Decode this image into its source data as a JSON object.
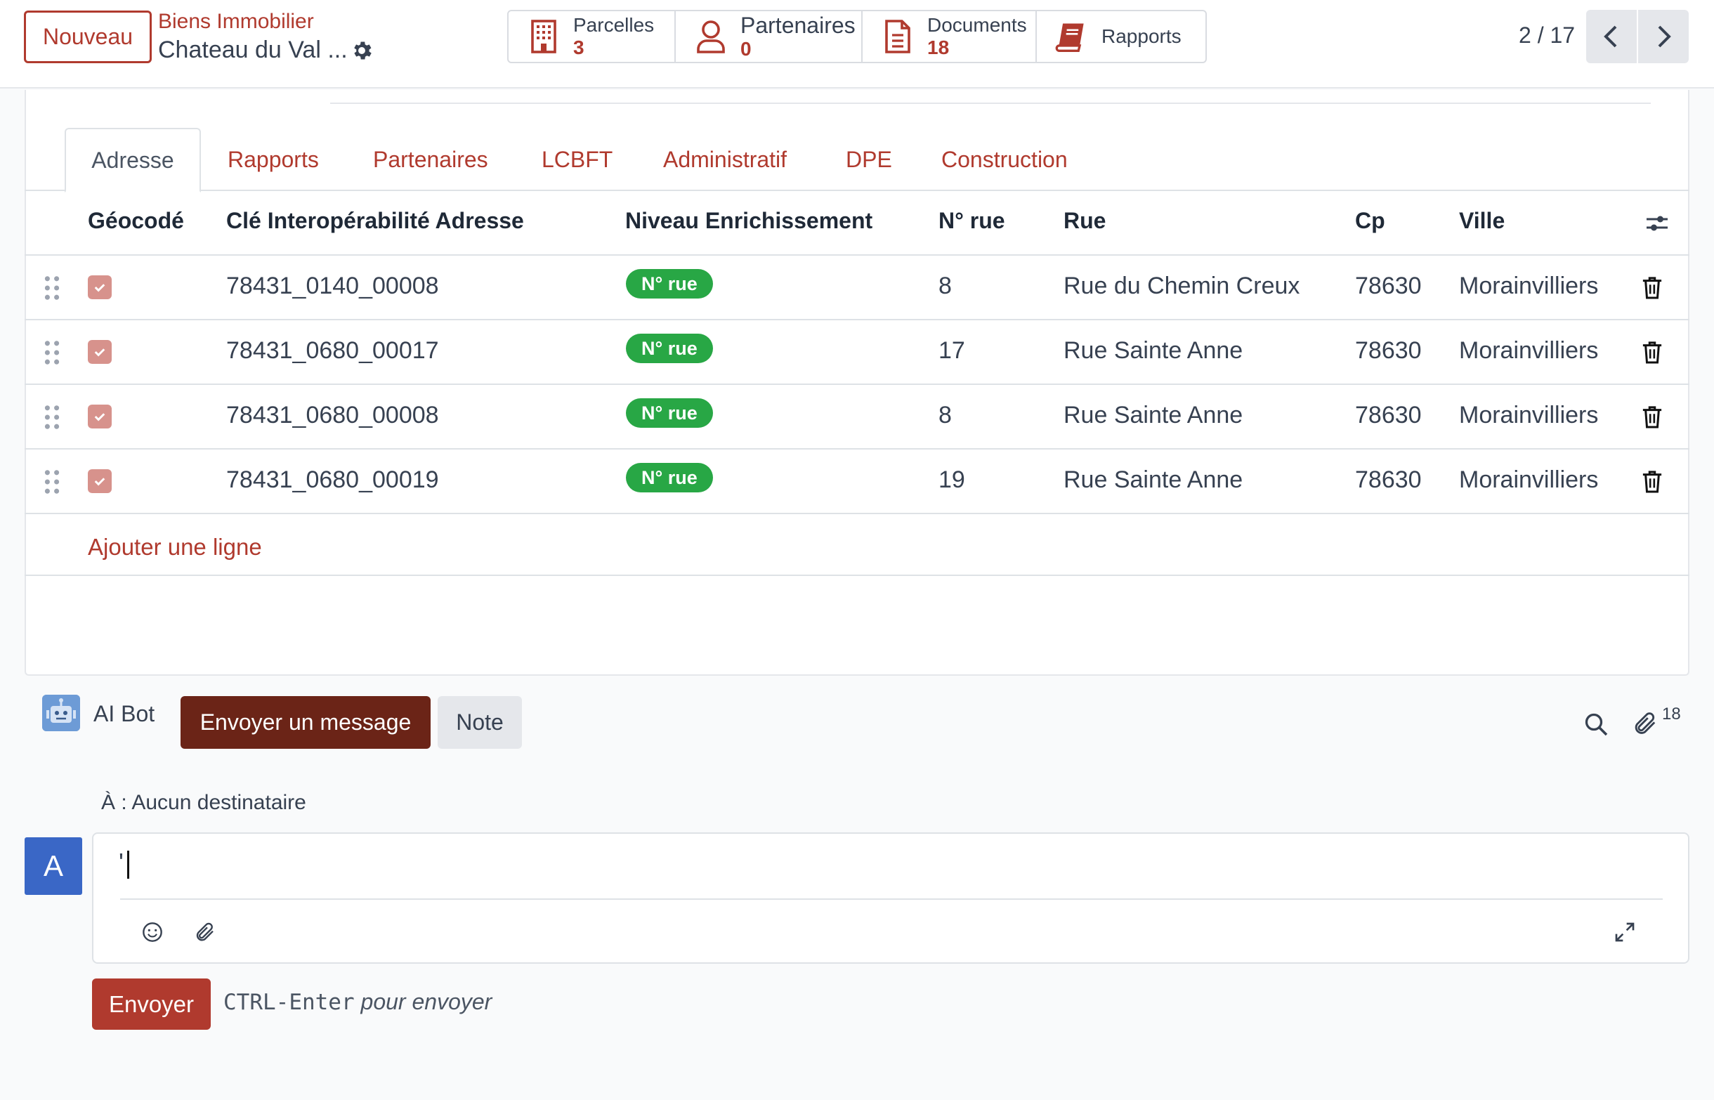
{
  "control_panel": {
    "new_button": "Nouveau",
    "breadcrumb_parent": "Biens Immobilier",
    "breadcrumb_current": "Chateau du Val ...",
    "pager": "2 / 17"
  },
  "smart_buttons": {
    "parcelles": {
      "label": "Parcelles",
      "value": "3",
      "icon": "building-icon"
    },
    "partenaires": {
      "label": "Partenaires",
      "value": "0",
      "icon": "user-icon"
    },
    "documents": {
      "label": "Documents",
      "value": "18",
      "icon": "file-icon"
    },
    "rapports": {
      "label": "Rapports",
      "icon": "book-icon"
    }
  },
  "tabs": [
    "Adresse",
    "Rapports",
    "Partenaires",
    "LCBFT",
    "Administratif",
    "DPE",
    "Construction"
  ],
  "table": {
    "headers": {
      "geocode": "Géocodé",
      "cle": "Clé Interopérabilité Adresse",
      "niveau": "Niveau Enrichissement",
      "num": "N° rue",
      "rue": "Rue",
      "cp": "Cp",
      "ville": "Ville"
    },
    "rows": [
      {
        "geocode": true,
        "cle": "78431_0140_00008",
        "niveau": "N° rue",
        "num": "8",
        "rue": "Rue du Chemin Creux",
        "cp": "78630",
        "ville": "Morainvilliers"
      },
      {
        "geocode": true,
        "cle": "78431_0680_00017",
        "niveau": "N° rue",
        "num": "17",
        "rue": "Rue Sainte Anne",
        "cp": "78630",
        "ville": "Morainvilliers"
      },
      {
        "geocode": true,
        "cle": "78431_0680_00008",
        "niveau": "N° rue",
        "num": "8",
        "rue": "Rue Sainte Anne",
        "cp": "78630",
        "ville": "Morainvilliers"
      },
      {
        "geocode": true,
        "cle": "78431_0680_00019",
        "niveau": "N° rue",
        "num": "19",
        "rue": "Rue Sainte Anne",
        "cp": "78630",
        "ville": "Morainvilliers"
      }
    ],
    "add_line": "Ajouter une ligne"
  },
  "chatter": {
    "bot_name": "AI Bot",
    "send_message_button": "Envoyer un message",
    "note_button": "Note",
    "attachment_count": "18",
    "recipients": "À : Aucun destinataire",
    "avatar_letter": "A",
    "composer_value": "'",
    "send_button": "Envoyer",
    "hint_key": "CTRL-Enter",
    "hint_text": "pour envoyer"
  },
  "colors": {
    "accent": "#b03a2e",
    "primary_dark": "#6b2417",
    "badge_success": "#28a745",
    "avatar": "#3a67c6"
  }
}
